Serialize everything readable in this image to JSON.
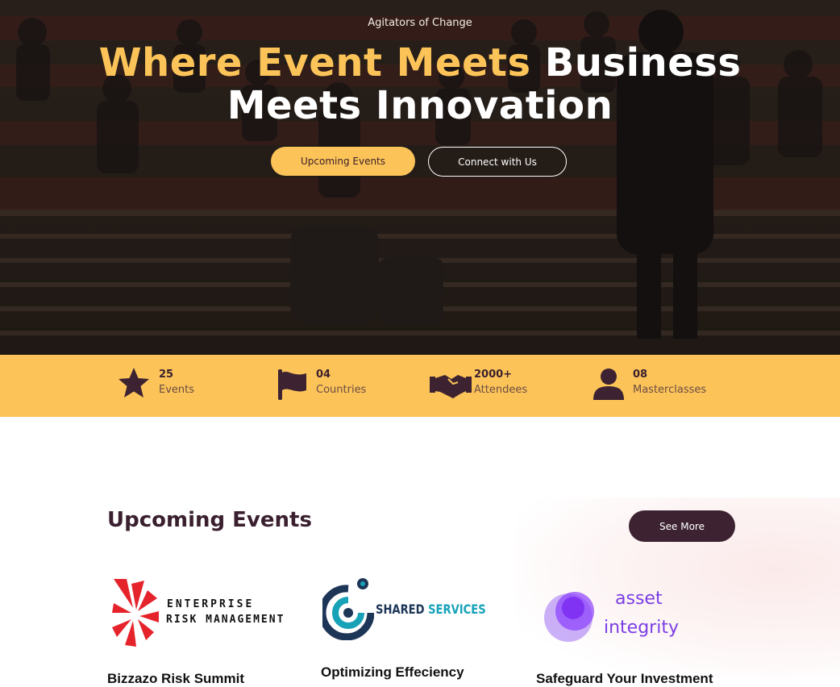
{
  "hero": {
    "tagline": "Agitators of Change",
    "headline_accent": "Where Event Meets",
    "headline_rest": " Business",
    "headline_line2": "Meets Innovation",
    "primary_button": "Upcoming Events",
    "secondary_button": "Connect with Us"
  },
  "stats": [
    {
      "icon": "star-icon",
      "value": "25",
      "label": "Events"
    },
    {
      "icon": "flag-icon",
      "value": "04",
      "label": "Countries"
    },
    {
      "icon": "handshake-icon",
      "value": "2000+",
      "label": "Attendees"
    },
    {
      "icon": "user-icon",
      "value": "08",
      "label": "Masterclasses"
    }
  ],
  "upcoming": {
    "title": "Upcoming Events",
    "see_more": "See More",
    "events": [
      {
        "logo_line1": "ENTERPRISE",
        "logo_line2": "RISK MANAGEMENT",
        "title": "Bizzazo Risk Summit"
      },
      {
        "logo_word1": "SHARED",
        "logo_word2": "SERVICES",
        "title": "Optimizing Effeciency"
      },
      {
        "logo_line1": "asset",
        "logo_line2": "integrity",
        "title": "Safeguard Your Investment"
      }
    ]
  },
  "colors": {
    "accent": "#fcc458",
    "brand_dark": "#3d2331",
    "teal": "#17a2b8",
    "purple": "#8a3ffc"
  }
}
